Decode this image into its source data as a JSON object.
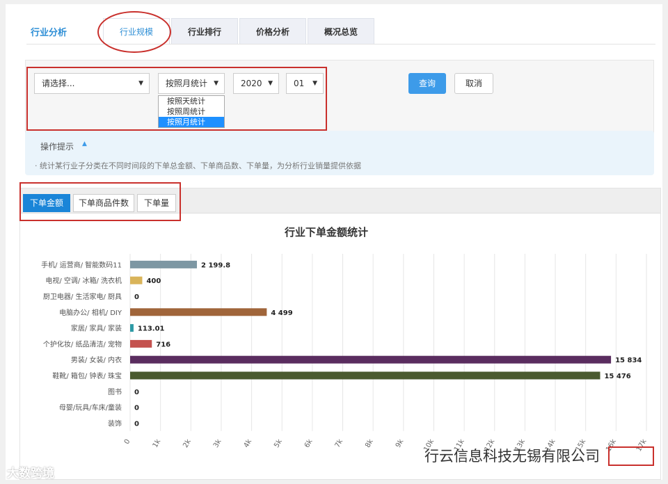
{
  "header": {
    "brand": "行业分析",
    "tabs": [
      {
        "label": "行业规模",
        "active": true
      },
      {
        "label": "行业排行",
        "active": false
      },
      {
        "label": "价格分析",
        "active": false
      },
      {
        "label": "概况总览",
        "active": false
      }
    ]
  },
  "filter": {
    "category_select": "请选择...",
    "period_select": "按照月统计",
    "period_options": [
      "按照天统计",
      "按照周统计",
      "按照月统计"
    ],
    "period_selected_index": 2,
    "year_select": "2020",
    "month_select": "01",
    "query_label": "查询",
    "cancel_label": "取消"
  },
  "hint": {
    "title": "操作提示",
    "text": "·  统计某行业子分类在不同时间段的下单总金额、下单商品数、下单量，为分析行业销量提供依据"
  },
  "chart_tabs": [
    {
      "label": "下单金额",
      "active": true
    },
    {
      "label": "下单商品件数",
      "active": false
    },
    {
      "label": "下单量",
      "active": false
    }
  ],
  "chart_data": {
    "type": "bar",
    "orientation": "horizontal",
    "title": "行业下单金额统计",
    "categories": [
      "手机/ 运营商/ 智能数码11",
      "电视/ 空调/ 冰箱/ 洗衣机",
      "厨卫电器/ 生活家电/ 厨具",
      "电脑办公/ 相机/ DIY",
      "家居/ 家具/ 家装",
      "个护化妆/ 纸品清洁/ 宠物",
      "男装/ 女装/ 内衣",
      "鞋靴/ 箱包/ 钟表/ 珠宝",
      "图书",
      "母婴/玩具/车床/童装",
      "装饰"
    ],
    "values": [
      2199.8,
      400,
      0,
      4499,
      113.01,
      716,
      15834,
      15476,
      0,
      0,
      0
    ],
    "value_labels": [
      "2 199.8",
      "400",
      "0",
      "4 499",
      "113.01",
      "716",
      "15 834",
      "15 476",
      "0",
      "0",
      "0"
    ],
    "colors": [
      "#7d97a3",
      "#d9b45a",
      "#9e9e9e",
      "#a0653a",
      "#2d9aa5",
      "#c4524f",
      "#5a2d5f",
      "#4a5a2f",
      "#999999",
      "#999999",
      "#999999"
    ],
    "x_ticks": [
      "0",
      "1k",
      "2k",
      "3k",
      "4k",
      "5k",
      "6k",
      "7k",
      "8k",
      "9k",
      "10k",
      "11k",
      "12k",
      "13k",
      "14k",
      "15k",
      "16k",
      "17k"
    ],
    "xlim": [
      0,
      17000
    ],
    "grid": true
  },
  "watermark": {
    "left": "大数跨境",
    "right": "行云信息科技无锡有限公司"
  }
}
